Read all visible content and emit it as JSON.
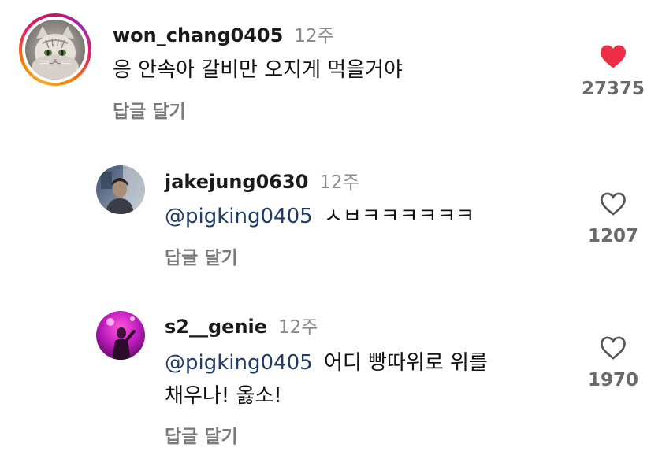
{
  "comments": [
    {
      "username": "won_chang0405",
      "time": "12주",
      "text": "응 안속아 갈비만 오지게 먹을거야",
      "reply_label": "답글 달기",
      "likes": "27375",
      "liked": true,
      "has_story_ring": true,
      "avatar_icon": "cat-avatar"
    },
    {
      "username": "jakejung0630",
      "time": "12주",
      "mention": "@pigking0405",
      "text": "ㅅㅂㅋㅋㅋㅋㅋㅋ",
      "reply_label": "답글 달기",
      "likes": "1207",
      "liked": false,
      "avatar_icon": "person-photo-avatar"
    },
    {
      "username": "s2__genie",
      "time": "12주",
      "mention": "@pigking0405",
      "text_line1": "어디 빵따위로 위를",
      "text_line2": "채우나! 옳소!",
      "reply_label": "답글 달기",
      "likes": "1970",
      "liked": false,
      "avatar_icon": "concert-photo-avatar"
    }
  ],
  "colors": {
    "heart_filled": "#ed2f45",
    "mention": "#1d3b66",
    "meta_gray": "#8a8a8a"
  }
}
